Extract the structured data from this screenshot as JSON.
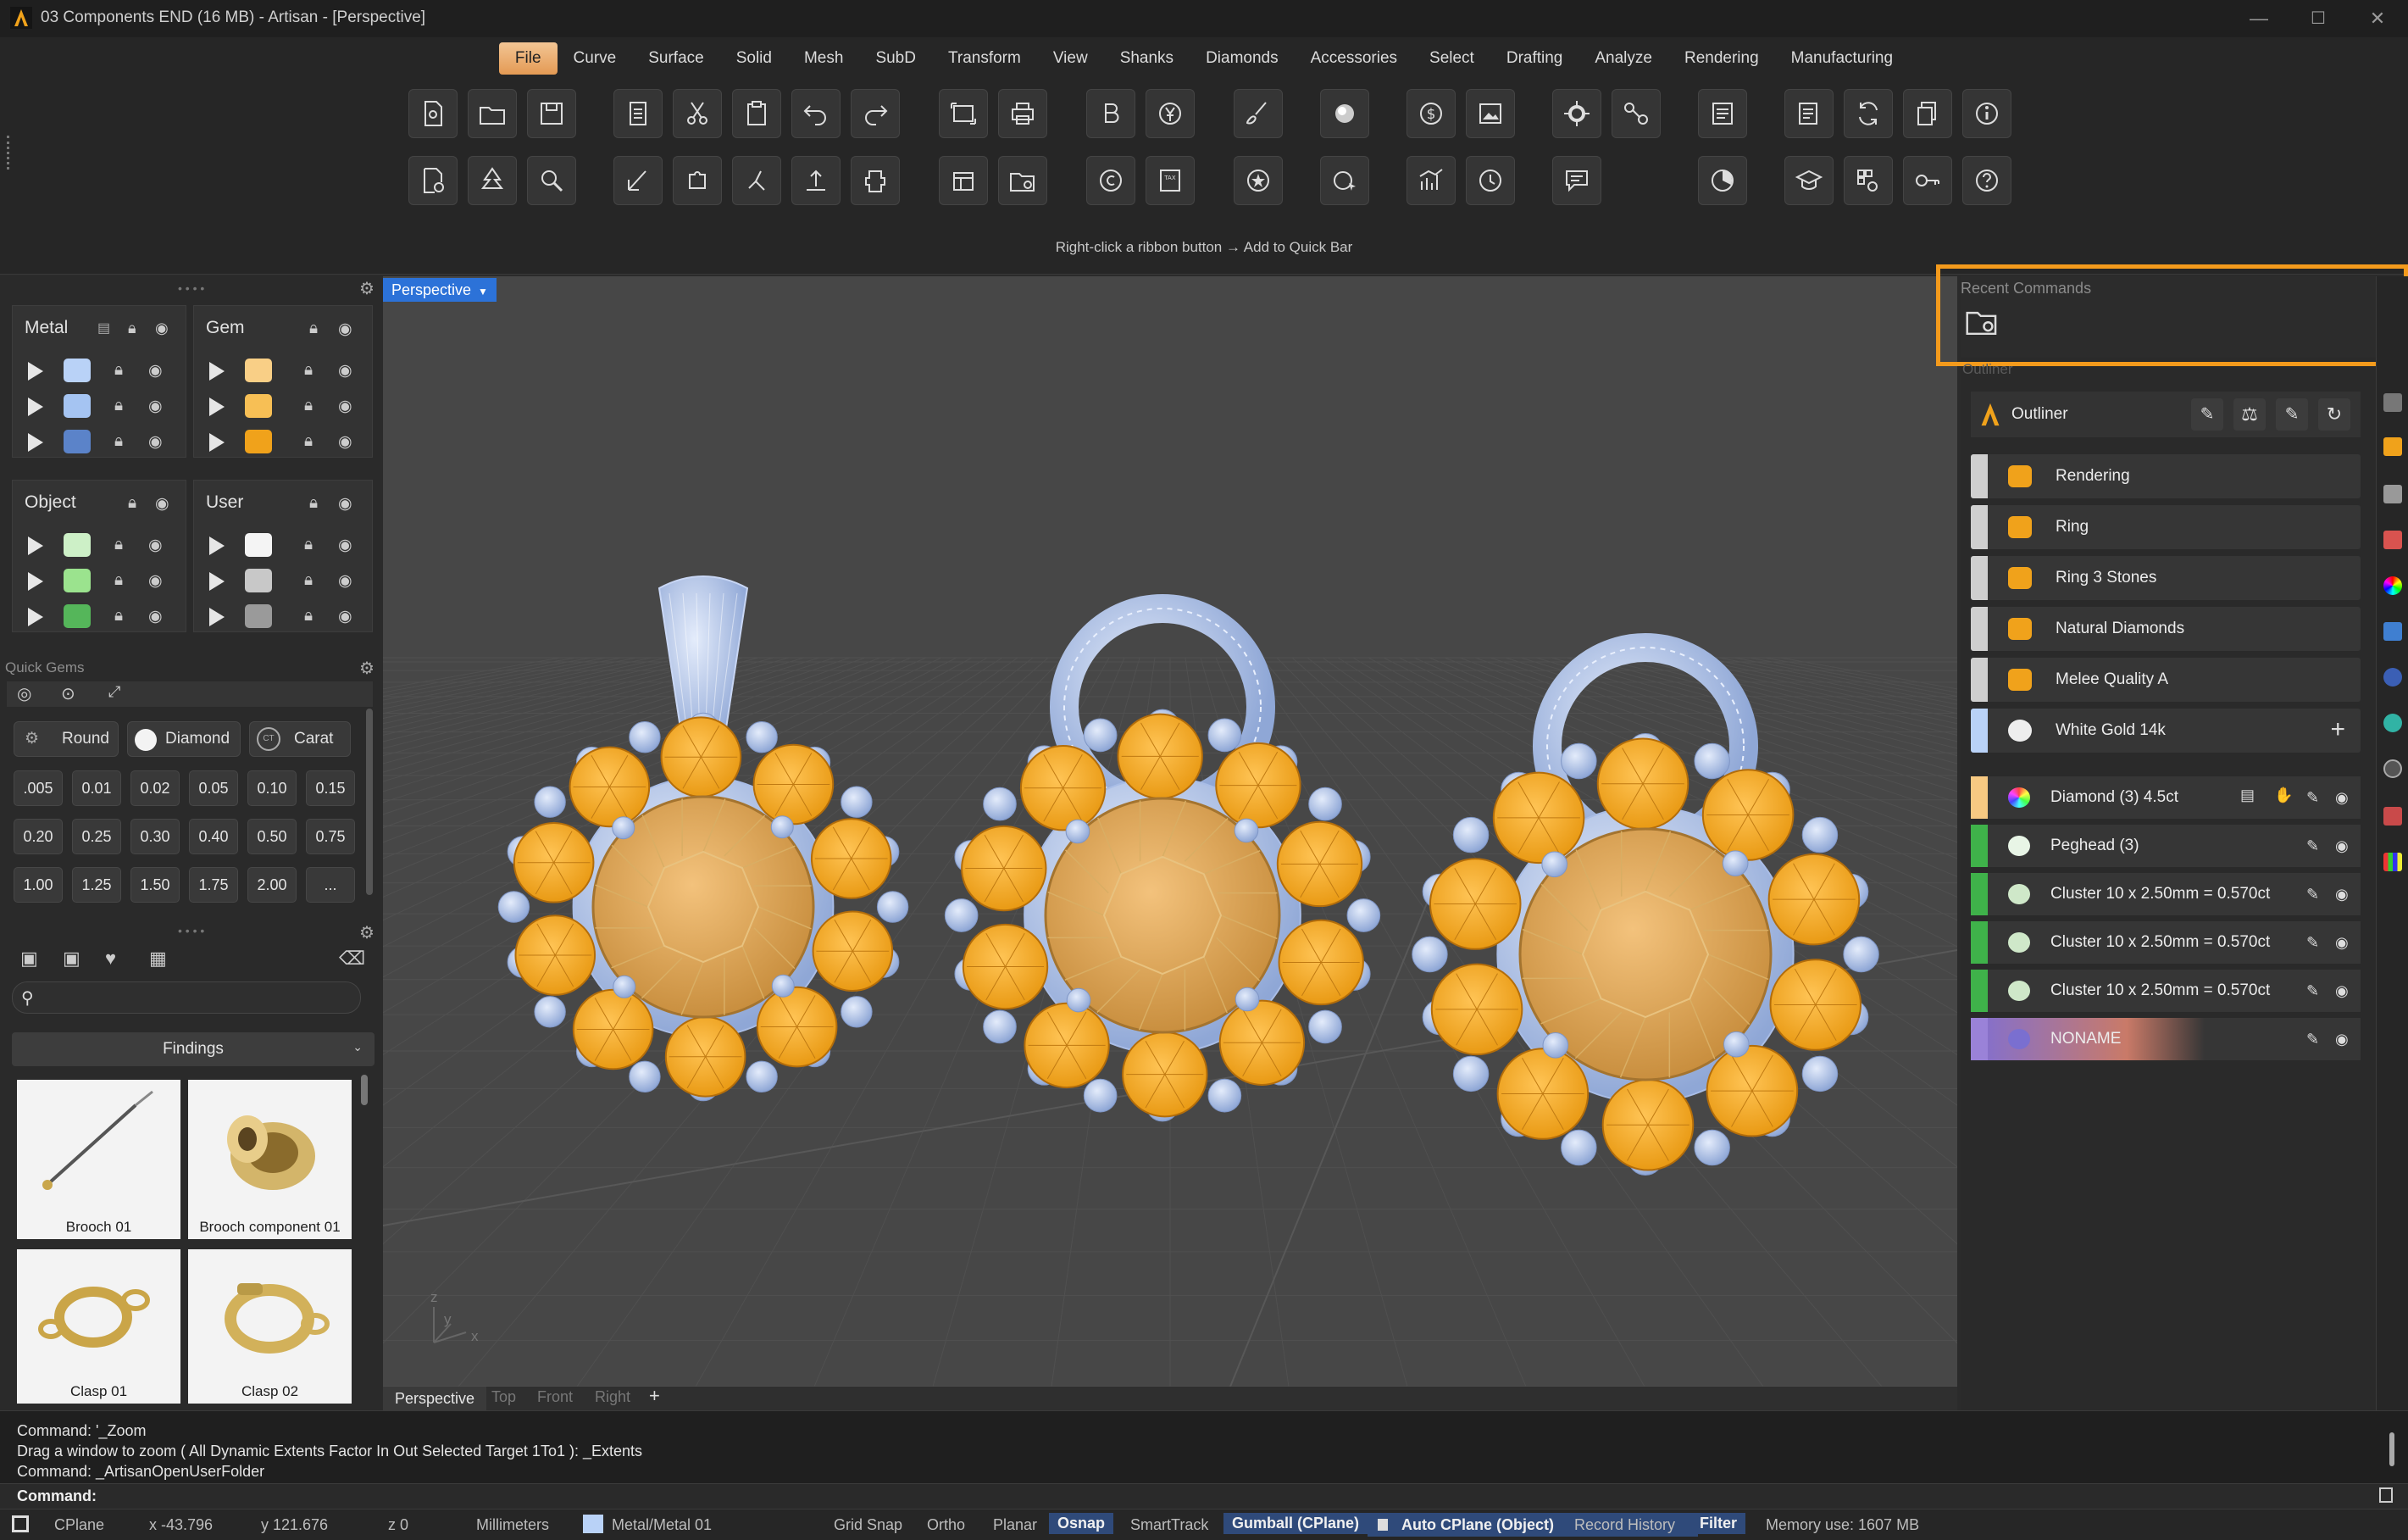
{
  "window": {
    "title": "03 Components END (16 MB) - Artisan - [Perspective]",
    "controls": [
      "—",
      "☐",
      "✕"
    ]
  },
  "ribbon": {
    "tabs": [
      "File",
      "Curve",
      "Surface",
      "Solid",
      "Mesh",
      "SubD",
      "Transform",
      "View",
      "Shanks",
      "Diamonds",
      "Accessories",
      "Select",
      "Drafting",
      "Analyze",
      "Rendering",
      "Manufacturing"
    ],
    "active_tab": "File",
    "quickbar_hint": "Right-click a ribbon button → Add to Quick Bar"
  },
  "layers": {
    "metal": {
      "title": "Metal",
      "swatches": [
        "#b9d2f7",
        "#a5c4f2",
        "#5b83c9"
      ]
    },
    "gem": {
      "title": "Gem",
      "swatches": [
        "#f9cf86",
        "#f7bf55",
        "#f0a21b"
      ]
    },
    "object": {
      "title": "Object",
      "swatches": [
        "#cdf0c7",
        "#9be38e",
        "#55b65a"
      ]
    },
    "user": {
      "title": "User",
      "swatches": [
        "#f4f4f4",
        "#c8c8c8",
        "#9a9a9a"
      ]
    }
  },
  "quick_gems": {
    "title": "Quick Gems",
    "shape_buttons": [
      "Round",
      "Diamond",
      "Carat"
    ],
    "carats": [
      ".005",
      "0.01",
      "0.02",
      "0.05",
      "0.10",
      "0.15",
      "0.20",
      "0.25",
      "0.30",
      "0.40",
      "0.50",
      "0.75",
      "1.00",
      "1.25",
      "1.50",
      "1.75",
      "2.00",
      "..."
    ]
  },
  "library": {
    "category": "Findings",
    "items": [
      "Brooch 01",
      "Brooch component 01",
      "Clasp 01",
      "Clasp 02"
    ]
  },
  "viewport": {
    "active": "Perspective",
    "tabs": [
      "Perspective",
      "Top",
      "Front",
      "Right",
      "+"
    ],
    "axis": {
      "z": "z",
      "y": "y",
      "x": "x"
    }
  },
  "recent_commands": {
    "title": "Recent Commands"
  },
  "outliner": {
    "header_ghost": "Outliner",
    "title": "Outliner",
    "materials": [
      {
        "label": "Rendering",
        "bar": "#cfcfcf"
      },
      {
        "label": "Ring",
        "bar": "#cfcfcf"
      },
      {
        "label": "Ring 3 Stones",
        "bar": "#cfcfcf"
      },
      {
        "label": "Natural Diamonds",
        "bar": "#cfcfcf"
      },
      {
        "label": "Melee Quality A",
        "bar": "#cfcfcf"
      },
      {
        "label": "White Gold 14k",
        "bar": "#b9d2f7",
        "add": "+"
      }
    ],
    "objects": [
      {
        "label": "Diamond (3) 4.5ct",
        "bar": "#f7c982"
      },
      {
        "label": "Peghead (3)",
        "bar": "#3fb24a"
      },
      {
        "label": "Cluster 10 x 2.50mm = 0.570ct",
        "bar": "#3fb24a"
      },
      {
        "label": "Cluster 10 x 2.50mm = 0.570ct",
        "bar": "#3fb24a"
      },
      {
        "label": "Cluster 10 x 2.50mm = 0.570ct",
        "bar": "#3fb24a"
      },
      {
        "label": "NONAME",
        "bar": "#9a82d8"
      }
    ]
  },
  "command_history": {
    "lines": [
      "Command: '_Zoom",
      "Drag a window to zoom ( All  Dynamic  Extents  Factor  In  Out  Selected  Target  1To1 ): _Extents",
      "Command: _ArtisanOpenUserFolder"
    ],
    "prompt": "Command:"
  },
  "status": {
    "cplane": "CPlane",
    "x": "x -43.796",
    "y": "y 121.676",
    "z": "z 0",
    "units": "Millimeters",
    "layer": "Metal/Metal 01",
    "grid_snap": "Grid Snap",
    "ortho": "Ortho",
    "planar": "Planar",
    "osnap": "Osnap",
    "smarttrack": "SmartTrack",
    "gumball": "Gumball (CPlane)",
    "auto_cplane": "Auto CPlane (Object)",
    "record_history": "Record History",
    "filter": "Filter",
    "memory": "Memory use: 1607 MB"
  }
}
